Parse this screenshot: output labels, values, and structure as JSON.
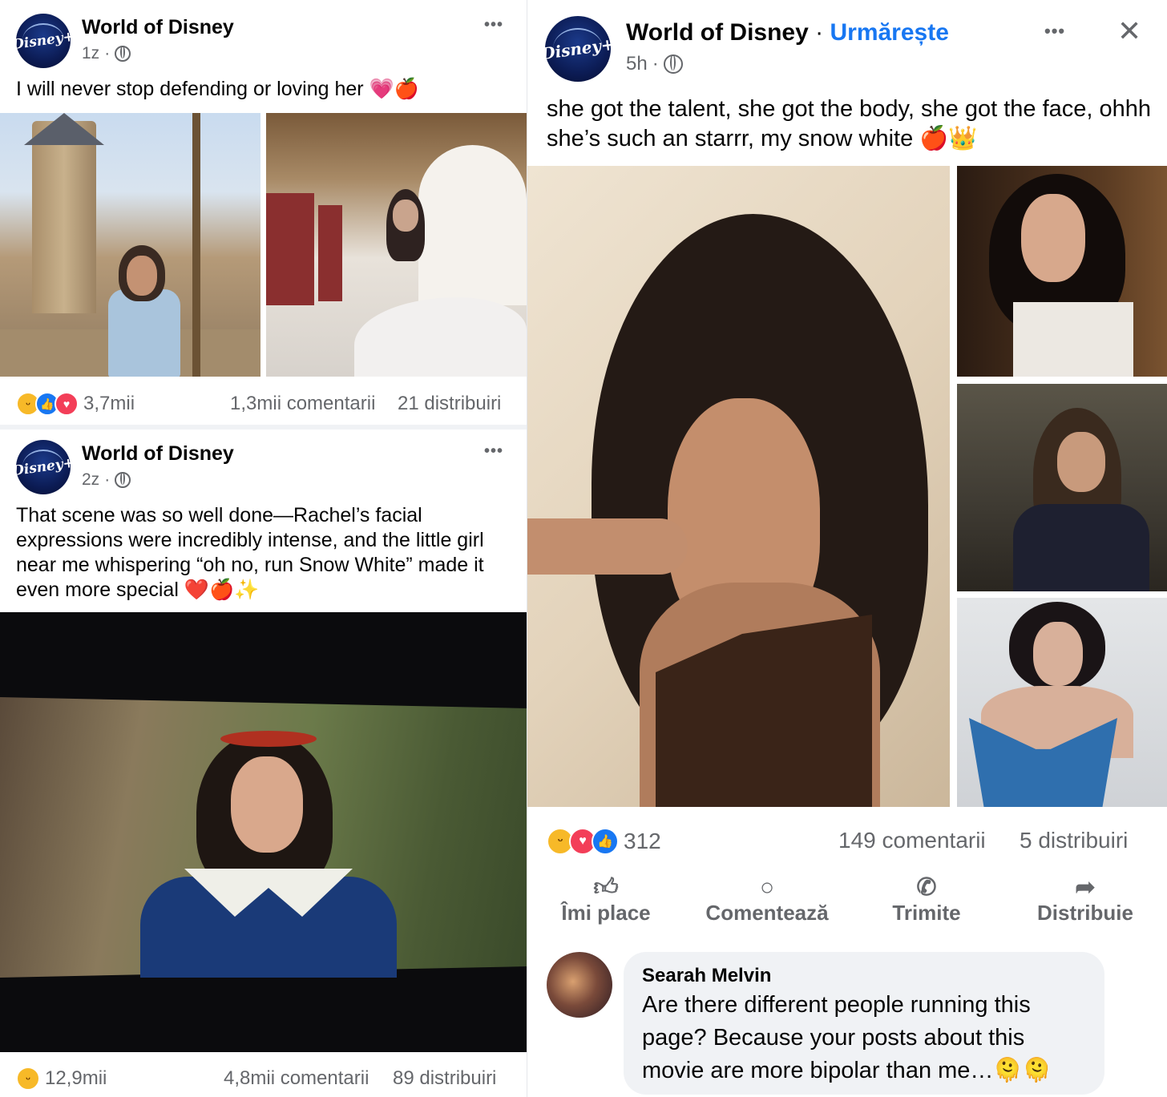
{
  "colors": {
    "accent": "#1877f2",
    "secondary_text": "#65676b",
    "love": "#f33e58",
    "haha": "#f7b928"
  },
  "left": {
    "posts": [
      {
        "page_name": "World of Disney",
        "time": "1z",
        "text": "I will never stop defending or loving her 💗🍎",
        "reactions_count": "3,7mii",
        "comments": "1,3mii comentarii",
        "shares": "21 distribuiri",
        "images": [
          "photo-castle-blue-dress",
          "photo-palace-white-gown"
        ]
      },
      {
        "page_name": "World of Disney",
        "time": "2z",
        "text": "That scene was so well done—Rachel’s facial expressions were incredibly intense, and the little girl near me whispering “oh no, run Snow White” made it even more special ❤️🍎✨",
        "reactions_count": "12,9mii",
        "comments": "4,8mii comentarii",
        "shares": "89 distribuiri",
        "images": [
          "photo-cinema-screen"
        ]
      }
    ]
  },
  "right": {
    "page_name": "World of Disney",
    "separator": " · ",
    "follow_label": "Urmărește",
    "time": "5h",
    "text": "she got the talent, she got the body, she got the face, ohhh she’s such an starrr, my snow white 🍎👑",
    "reactions_count": "312",
    "comments": "149 comentarii",
    "shares": "5 distribuiri",
    "actions": [
      {
        "label": "Îmi place",
        "icon": "like-icon"
      },
      {
        "label": "Comentează",
        "icon": "comment-icon"
      },
      {
        "label": "Trimite",
        "icon": "whatsapp-icon"
      },
      {
        "label": "Distribuie",
        "icon": "share-icon"
      }
    ],
    "comment": {
      "author": "Searah Melvin",
      "text": "Are there different people running this page? Because your posts about this movie are more bipolar than me…🫠🫠"
    }
  },
  "avatar_text": "Disney+",
  "more_glyph": "•••",
  "close_glyph": "✕"
}
